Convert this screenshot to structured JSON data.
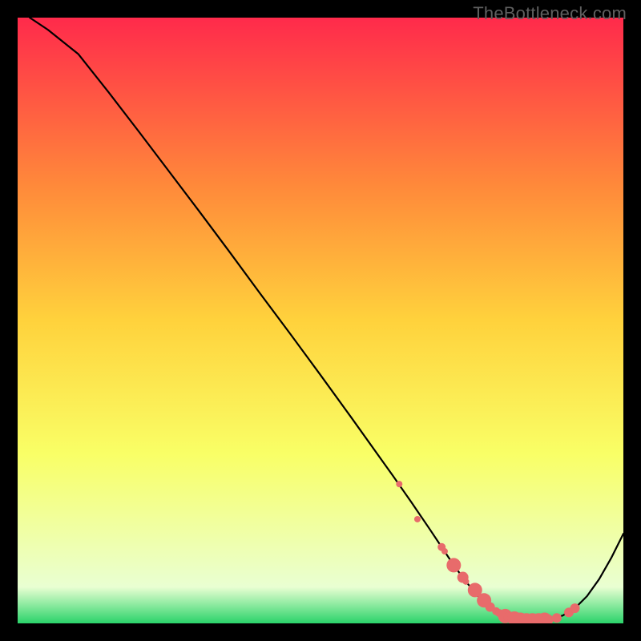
{
  "watermark": "TheBottleneck.com",
  "colors": {
    "bg": "#000000",
    "gradient_top": "#ff2a4b",
    "gradient_mid_upper": "#ff8a3a",
    "gradient_mid": "#ffd23c",
    "gradient_mid_lower": "#f9ff66",
    "gradient_low": "#e9ffd2",
    "gradient_bottom": "#2bd36a",
    "curve": "#000000",
    "marker_fill": "#e86b6b",
    "marker_stroke": "#d94f4f"
  },
  "chart_data": {
    "type": "line",
    "title": "",
    "xlabel": "",
    "ylabel": "",
    "xlim": [
      0,
      100
    ],
    "ylim": [
      0,
      100
    ],
    "grid": false,
    "legend": false,
    "series": [
      {
        "name": "curve",
        "x": [
          2,
          5,
          10,
          15,
          20,
          25,
          30,
          35,
          40,
          45,
          50,
          55,
          60,
          62,
          65,
          68,
          70,
          72,
          74,
          76,
          78,
          80,
          82,
          84,
          86,
          88,
          90,
          92,
          94,
          96,
          98,
          100
        ],
        "y": [
          100,
          98,
          94,
          87.7,
          81.2,
          74.6,
          68,
          61.3,
          54.5,
          47.8,
          41,
          34.1,
          27.1,
          24.3,
          20,
          15.6,
          12.6,
          9.6,
          6.9,
          4.5,
          2.7,
          1.5,
          0.8,
          0.5,
          0.5,
          0.7,
          1.3,
          2.5,
          4.5,
          7.3,
          10.8,
          14.8
        ]
      }
    ],
    "markers": {
      "name": "trough-points",
      "x": [
        63,
        66,
        70,
        70.5,
        72,
        73.5,
        74,
        75.5,
        77,
        78,
        79,
        79.5,
        80.5,
        81,
        82,
        83,
        84,
        85,
        86,
        87,
        87.5,
        89,
        91,
        92
      ],
      "y": [
        23.0,
        17.2,
        12.6,
        11.9,
        9.6,
        7.6,
        6.9,
        5.5,
        3.8,
        2.7,
        2.0,
        1.7,
        1.2,
        1.0,
        0.8,
        0.6,
        0.5,
        0.5,
        0.5,
        0.6,
        0.6,
        0.9,
        1.8,
        2.5
      ],
      "r": [
        4,
        4,
        5,
        4,
        9,
        7,
        4,
        9,
        9,
        6,
        5,
        5,
        9,
        6,
        9,
        9,
        9,
        9,
        9,
        9,
        7,
        6,
        6,
        6
      ]
    }
  }
}
